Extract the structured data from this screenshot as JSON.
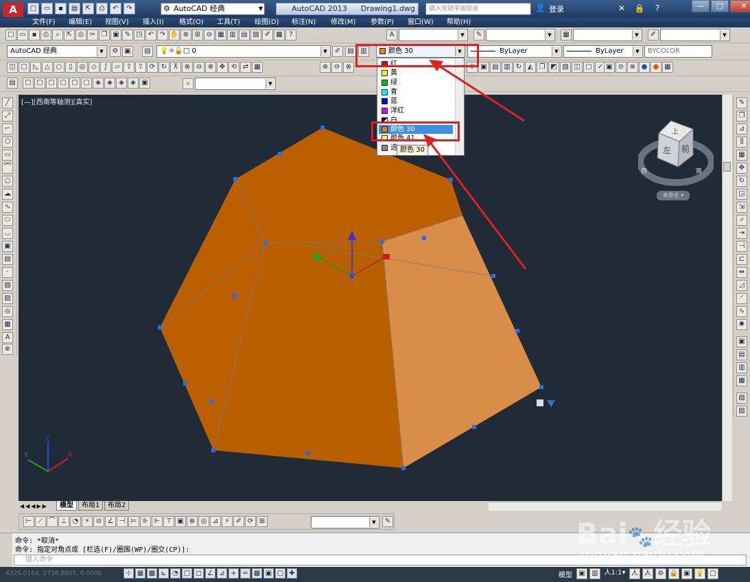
{
  "titlebar": {
    "app_logo": "A",
    "workspace": "AutoCAD 经典",
    "app_name": "AutoCAD 2013",
    "doc_name": "Drawing1.dwg",
    "search_placeholder": "键入关键字或短语",
    "login": "登录"
  },
  "menu": [
    "文件(F)",
    "编辑(E)",
    "视图(V)",
    "插入(I)",
    "格式(O)",
    "工具(T)",
    "绘图(D)",
    "标注(N)",
    "修改(M)",
    "参数(P)",
    "窗口(W)",
    "帮助(H)"
  ],
  "properties": {
    "workspace_combo": "AutoCAD 经典",
    "layer_combo": "0",
    "color_combo": "颜色 30",
    "linetype_combo": "ByLayer",
    "lineweight_combo": "ByLayer",
    "plotstyle_combo": "BYCOLOR"
  },
  "color_dropdown": {
    "items": [
      {
        "label": "红",
        "color": "#e00000"
      },
      {
        "label": "黄",
        "color": "#ffff00"
      },
      {
        "label": "绿",
        "color": "#00c000"
      },
      {
        "label": "青",
        "color": "#00ffff"
      },
      {
        "label": "蓝",
        "color": "#0000e0"
      },
      {
        "label": "洋红",
        "color": "#e000e0"
      },
      {
        "label": "白",
        "color": "#000000"
      },
      {
        "label": "颜色 30",
        "color": "#f08010",
        "selected": true
      },
      {
        "label": "颜色 41",
        "color": "#ffff80"
      },
      {
        "label": "选",
        "color": "#888888"
      }
    ],
    "tooltip": "颜色 30"
  },
  "viewport": {
    "label": "[—][西南等轴测][真实]",
    "viewcube_top": "上",
    "viewcube_left": "左",
    "viewcube_front": "前",
    "viewcube_west": "西",
    "viewcube_south": "南",
    "ucs_name": "未命名",
    "solid_color_main": "#bb5f00",
    "solid_color_light": "#d98d49",
    "grip_color": "#2a6fe0"
  },
  "tabs": [
    "模型",
    "布局1",
    "布局2"
  ],
  "command": {
    "line1": "命令: *取消*",
    "line2": "命令: 指定对角点或 [栏选(F)/圈围(WP)/圈交(CP)]:",
    "placeholder": "键入命令"
  },
  "status": {
    "coords": "4325.0164, 2738.8805, 0.0000",
    "model": "模型",
    "scale": "1:1"
  },
  "watermark": {
    "brand": "Bai",
    "brand2": "经验",
    "url": "jingyan.baidu.com"
  }
}
